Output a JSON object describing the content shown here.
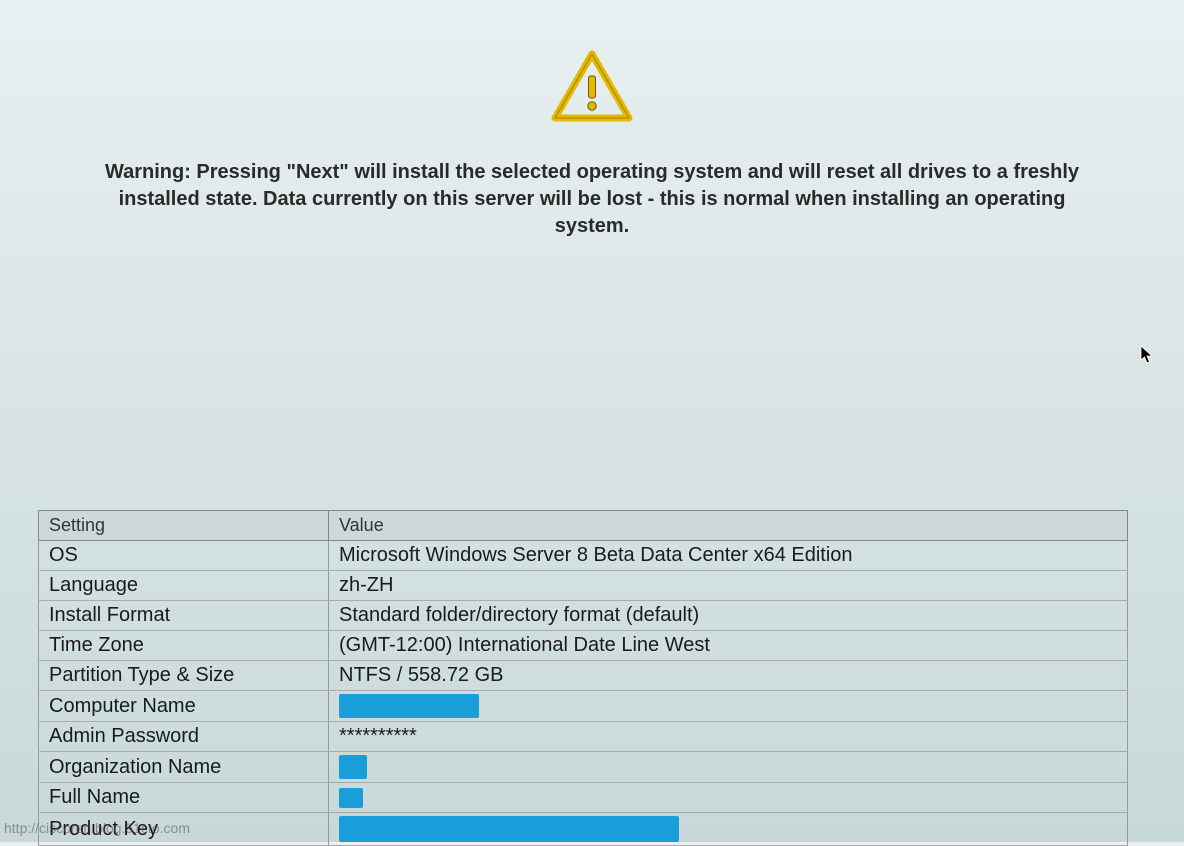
{
  "warning": {
    "text": "Warning: Pressing \"Next\" will install the selected operating system and will reset all drives to a freshly installed state. Data currently on this server will be lost - this is normal when installing an operating system."
  },
  "table": {
    "headers": {
      "setting": "Setting",
      "value": "Value"
    },
    "rows": [
      {
        "setting": "OS",
        "value": "Microsoft Windows Server 8 Beta Data Center x64 Edition",
        "redacted": false
      },
      {
        "setting": "Language",
        "value": "zh-ZH",
        "redacted": false
      },
      {
        "setting": "Install Format",
        "value": "Standard folder/directory format (default)",
        "redacted": false
      },
      {
        "setting": "Time Zone",
        "value": "(GMT-12:00) International Date Line West",
        "redacted": false
      },
      {
        "setting": "Partition Type & Size",
        "value": "NTFS / 558.72 GB",
        "redacted": false
      },
      {
        "setting": "Computer Name",
        "value": "",
        "redacted": true,
        "redact_class": "redact-computer"
      },
      {
        "setting": "Admin Password",
        "value": "**********",
        "redacted": false
      },
      {
        "setting": "Organization Name",
        "value": "",
        "redacted": true,
        "redact_class": "redact-org"
      },
      {
        "setting": "Full Name",
        "value": "",
        "redacted": true,
        "redact_class": "redact-full"
      },
      {
        "setting": "Product Key",
        "value": "",
        "redacted": true,
        "redact_class": "redact-key"
      }
    ]
  },
  "watermark": "http://ciscoren.blog.51cto.com"
}
